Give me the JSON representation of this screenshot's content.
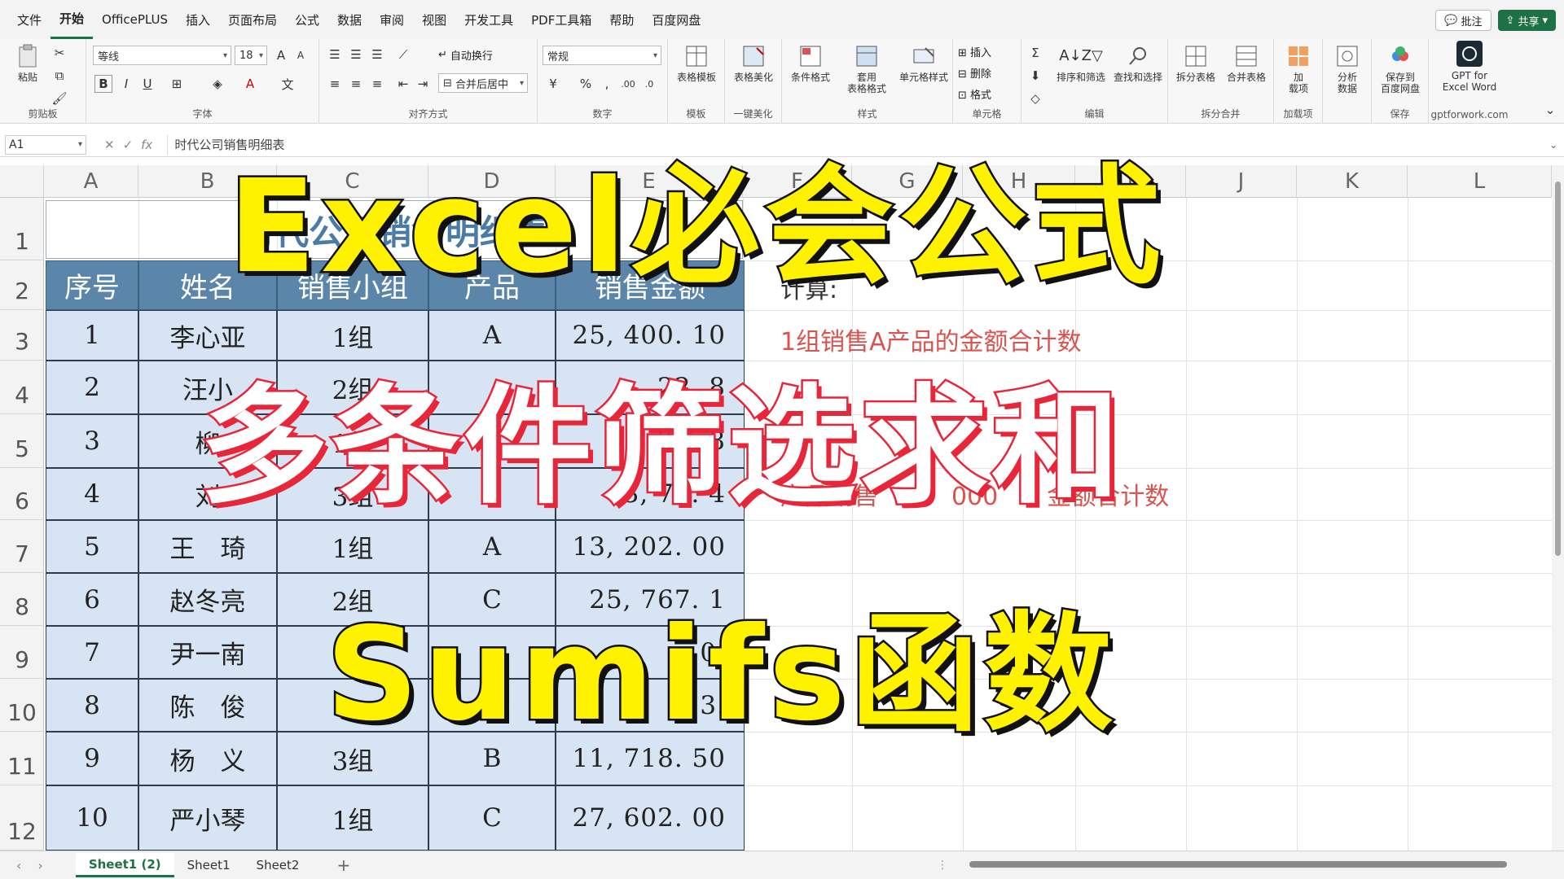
{
  "menu": [
    "文件",
    "开始",
    "OfficePLUS",
    "插入",
    "页面布局",
    "公式",
    "数据",
    "审阅",
    "视图",
    "开发工具",
    "PDF工具箱",
    "帮助",
    "百度网盘"
  ],
  "menu_active_index": 1,
  "top_right": {
    "comment": "批注",
    "share": "共享"
  },
  "ribbon": {
    "clipboard": {
      "paste": "粘贴",
      "label": "剪贴板"
    },
    "font": {
      "name": "等线",
      "size": "18",
      "label": "字体"
    },
    "alignment": {
      "wrap": "自动换行",
      "merge": "合并后居中",
      "label": "对齐方式"
    },
    "number": {
      "format": "常规",
      "label": "数字"
    },
    "template": {
      "btn": "表格模板",
      "label": "模板"
    },
    "beautify": {
      "btn": "表格美化",
      "label": "一键美化"
    },
    "styles": {
      "cond": "条件格式",
      "table": "套用\n表格格式",
      "cell": "单元格样式",
      "label": "样式"
    },
    "cells": {
      "insert": "插入",
      "delete": "删除",
      "format": "格式",
      "label": "单元格"
    },
    "editing": {
      "sort": "排序和筛选",
      "find": "查找和选择",
      "label": "编辑"
    },
    "split": {
      "split": "拆分表格",
      "merge": "合并表格",
      "label": "拆分合并"
    },
    "addin": {
      "btn": "加\n载项",
      "label": "加载项"
    },
    "analyze": {
      "btn": "分析\n数据"
    },
    "save": {
      "btn": "保存到\n百度网盘",
      "label": "保存"
    },
    "gpt": {
      "btn": "GPT for\nExcel Word",
      "label": "gptforwork.com"
    }
  },
  "formula_bar": {
    "name_box": "A1",
    "formula": "时代公司销售明细表"
  },
  "columns": [
    "A",
    "B",
    "C",
    "D",
    "E",
    "F",
    "G",
    "H",
    "I",
    "J",
    "K",
    "L"
  ],
  "rows": [
    "1",
    "2",
    "3",
    "4",
    "5",
    "6",
    "7",
    "8",
    "9",
    "10",
    "11",
    "12"
  ],
  "sheet_title": "时代公司销售明细表",
  "table": {
    "headers": [
      "序号",
      "姓名",
      "销售小组",
      "产品",
      "销售金额"
    ],
    "rows": [
      [
        "1",
        "李心亚",
        "1组",
        "A",
        "25, 400. 10"
      ],
      [
        "2",
        "汪小",
        "2组",
        "",
        "22. 8"
      ],
      [
        "3",
        "柳",
        "1组",
        "",
        "20. 8"
      ],
      [
        "4",
        "刘",
        "3组",
        "",
        "43, 74. 4"
      ],
      [
        "5",
        "王　琦",
        "1组",
        "A",
        "13, 202. 00"
      ],
      [
        "6",
        "赵冬亮",
        "2组",
        "C",
        "25, 767. 1"
      ],
      [
        "7",
        "尹一南",
        "2",
        "",
        "0."
      ],
      [
        "8",
        "陈　俊",
        "",
        "",
        "3."
      ],
      [
        "9",
        "杨　义",
        "3组",
        "B",
        "11, 718. 50"
      ],
      [
        "10",
        "严小琴",
        "1组",
        "C",
        "27, 602. 00"
      ]
    ]
  },
  "notes": {
    "calc": "计算:",
    "q1": "1组销售A产品的金额合计数",
    "q2": "产品销售　　　000　　金额合计数"
  },
  "overlay": {
    "line1": "Excel必会公式",
    "line2": "多条件筛选求和",
    "line3": "Sumifs函数"
  },
  "sheet_tabs": [
    "Sheet1 (2)",
    "Sheet1",
    "Sheet2"
  ],
  "active_tab_index": 0,
  "add_sheet": "+",
  "colors": {
    "header_bg": "#5b86aa",
    "cell_bg": "#d6e4f3",
    "accent": "#1e7145",
    "note": "#d9534f",
    "overlay_yellow": "#fff200",
    "overlay_red": "#e8263a"
  }
}
